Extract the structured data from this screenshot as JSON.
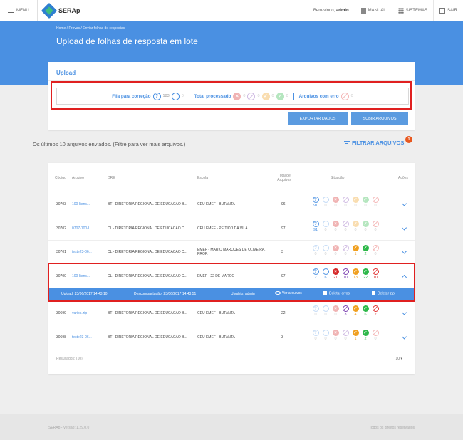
{
  "topbar": {
    "menu_label": "MENU",
    "app_name": "SERAp",
    "welcome_prefix": "Bem-vindo,",
    "user": "admin",
    "manual": "MANUAL",
    "sistemas": "SISTEMAS",
    "sair": "SAIR"
  },
  "header": {
    "breadcrumb": "Home / Provas / Enviar folhas de respostas",
    "title": "Upload de folhas de resposta em lote"
  },
  "upload": {
    "title": "Upload",
    "fila_label": "Fila para correção",
    "fila_values": [
      "183",
      "0"
    ],
    "total_label": "Total processado",
    "total_values": [
      "0",
      "0",
      "0",
      "0"
    ],
    "erro_label": "Arquivos com erro",
    "erro_value": "0",
    "export_btn": "EXPORTAR DADOS",
    "submit_btn": "SUBIR ARQUIVOS"
  },
  "list": {
    "info": "Os últimos 10 arquivos enviados. (Filtre para ver mais arquivos.)",
    "filter_label": "FILTRAR ARQUIVOS",
    "filter_badge": "1"
  },
  "table": {
    "headers": {
      "codigo": "Código",
      "arquivo": "Arquivo",
      "dre": "DRE",
      "escola": "Escola",
      "total": "Total de Arquivos",
      "situacao": "Situação",
      "acoes": "Ações"
    },
    "rows": [
      {
        "codigo": "30703",
        "arquivo": "100-Itens....",
        "dre": "BT - DIRETORIA REGIONAL DE EDUCACAO B...",
        "escola": "CEU EMEF - BUTANTA",
        "total": "96",
        "counts": [
          "91",
          "0",
          "0",
          "0",
          "0",
          "0",
          "0"
        ],
        "faded": true
      },
      {
        "codigo": "30702",
        "arquivo": "0707-100-I...",
        "dre": "CL - DIRETORIA REGIONAL DE EDUCACAO C...",
        "escola": "CEU EMEF - PEITICO DA VILA",
        "total": "97",
        "counts": [
          "91",
          "0",
          "0",
          "0",
          "0",
          "0",
          "0"
        ],
        "faded": true
      },
      {
        "codigo": "30701",
        "arquivo": "teste23-06...",
        "dre": "CL - DIRETORIA REGIONAL DE EDUCACAO C...",
        "escola": "EMEF - MARIO MARQUES DE OLIVEIRA, PROF.",
        "total": "3",
        "counts": [
          "0",
          "0",
          "0",
          "0",
          "1",
          "2",
          "0"
        ],
        "faded": false
      },
      {
        "codigo": "30700",
        "arquivo": "100-Itens....",
        "dre": "CL - DIRETORIA REGIONAL DE EDUCACAO C...",
        "escola": "EMEF - 22 DE MARCO",
        "total": "97",
        "counts": [
          "2",
          "6",
          "21",
          "10",
          "13",
          "22",
          "10"
        ],
        "faded": false
      },
      {
        "codigo": "30699",
        "arquivo": "varios.zip",
        "dre": "BT - DIRETORIA REGIONAL DE EDUCACAO B...",
        "escola": "CEU EMEF - BUTANTA",
        "total": "22",
        "counts": [
          "0",
          "0",
          "0",
          "3",
          "4",
          "6",
          "2"
        ],
        "faded": false
      },
      {
        "codigo": "30698",
        "arquivo": "teste23-06...",
        "dre": "BT - DIRETORIA REGIONAL DE EDUCACAO B...",
        "escola": "CEU EMEF - BUTANTA",
        "total": "3",
        "counts": [
          "0",
          "0",
          "0",
          "0",
          "1",
          "2",
          "0"
        ],
        "faded": false
      }
    ],
    "detail": {
      "upload": "Upload: 23/06/2017 14:43:10",
      "descompactacao": "Descompactação: 23/06/2017 14:43:51",
      "usuario": "Usuário: admin",
      "ver": "Ver arquivos",
      "deletar_erros": "Deletar erros",
      "deletar_zip": "Deletar zip"
    },
    "results": "Resultados: (10)",
    "pager": "10"
  },
  "footer": {
    "left": "SERAp - Versão: 1.29.0.0",
    "right": "Todos os direitos reservados"
  }
}
